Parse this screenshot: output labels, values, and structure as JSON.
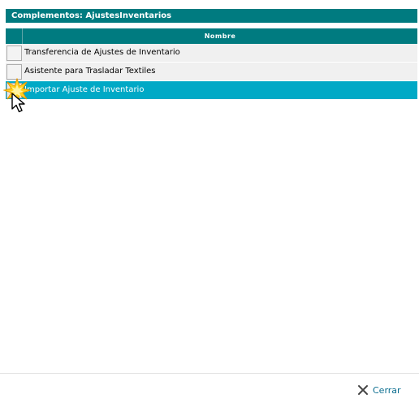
{
  "dialog": {
    "title": "Complementos: AjustesInventarios"
  },
  "grid": {
    "column_header": "Nombre",
    "rows": [
      {
        "name": "Transferencia de Ajustes de Inventario",
        "selected": false
      },
      {
        "name": "Asistente para Trasladar Textiles",
        "selected": false
      },
      {
        "name": "Importar Ajuste de Inventario",
        "selected": true
      }
    ]
  },
  "footer": {
    "close_label": "Cerrar",
    "close_icon": "close-x-icon"
  },
  "colors": {
    "header_bg": "#007b80",
    "selected_row_bg": "#00a9c6",
    "row_bg": "#f0f0f0",
    "link": "#0a6d8f"
  }
}
